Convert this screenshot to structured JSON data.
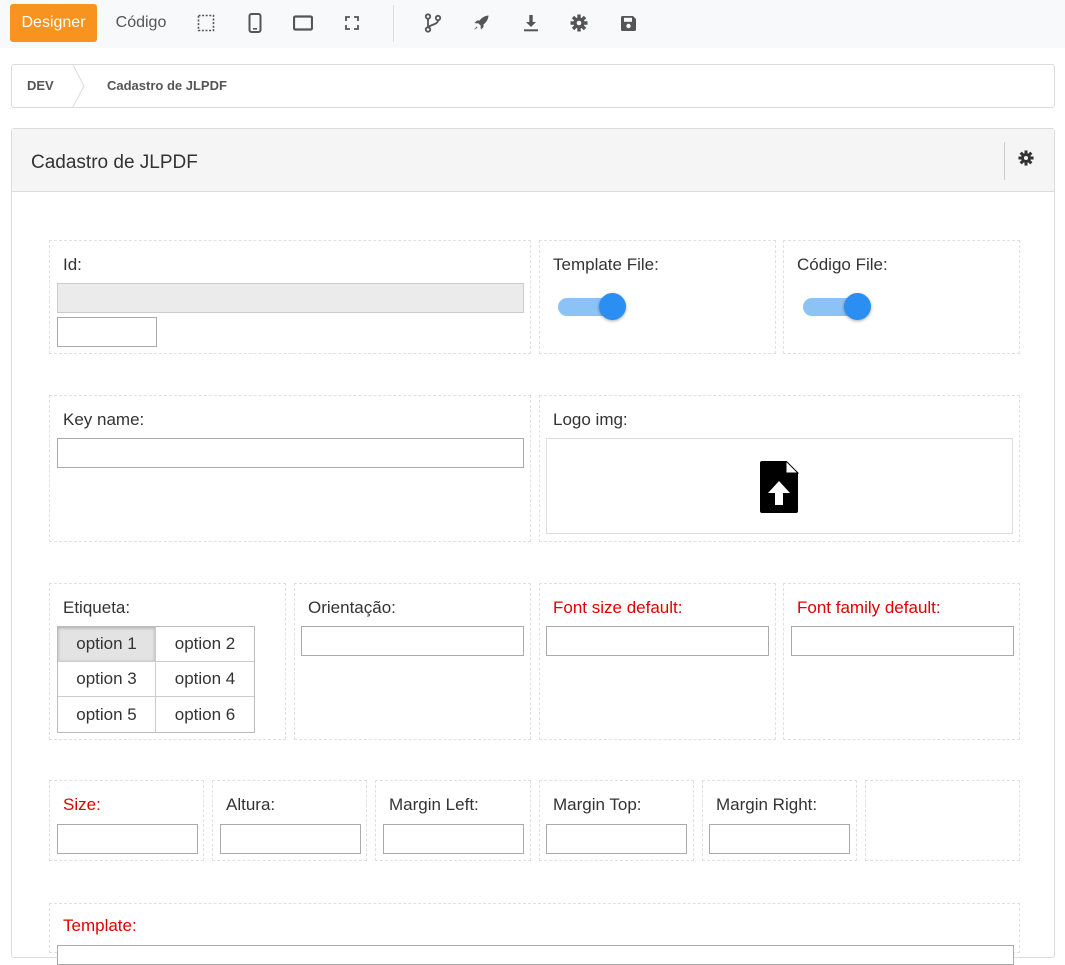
{
  "toolbar": {
    "designer_label": "Designer",
    "codigo_label": "Código",
    "icons": [
      "selection-icon",
      "mobile-icon",
      "tablet-icon",
      "fullscreen-icon",
      "branch-icon",
      "rocket-icon",
      "download-icon",
      "gear-icon",
      "save-icon"
    ]
  },
  "breadcrumb": {
    "root": "DEV",
    "current": "Cadastro de JLPDF"
  },
  "panel": {
    "title": "Cadastro de JLPDF"
  },
  "form": {
    "id_label": "Id:",
    "id_value": "",
    "id_extra_value": "",
    "template_file_label": "Template File:",
    "template_file_on": true,
    "codigo_file_label": "Código File:",
    "codigo_file_on": true,
    "key_name_label": "Key name:",
    "key_name_value": "",
    "logo_img_label": "Logo img:",
    "etiqueta_label": "Etiqueta:",
    "etiqueta_options": [
      "option 1",
      "option 2",
      "option 3",
      "option 4",
      "option 5",
      "option 6"
    ],
    "etiqueta_selected": "option 1",
    "orientacao_label": "Orientação:",
    "font_size_label": "Font size default:",
    "font_family_label": "Font family default:",
    "size_label": "Size:",
    "altura_label": "Altura:",
    "margin_left_label": "Margin Left:",
    "margin_top_label": "Margin Top:",
    "margin_right_label": "Margin Right:",
    "template_label": "Template:"
  },
  "colors": {
    "accent": "#f7931e",
    "toggle_knob": "#2b8ef2",
    "toggle_track": "#8cc3f7",
    "required_label": "#e00000"
  }
}
